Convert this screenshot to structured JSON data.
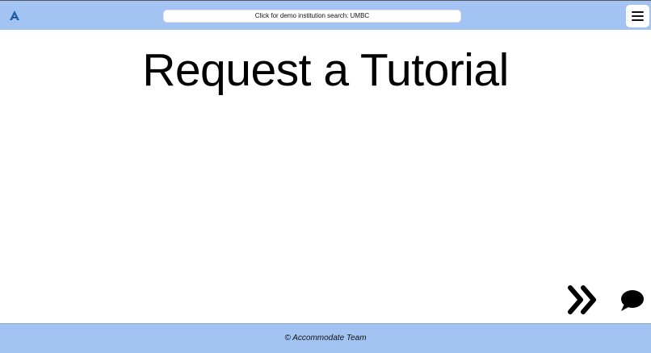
{
  "header": {
    "logo_icon": "accommodate-logo-icon",
    "demo_search_label": "Click for demo institution search: UMBC",
    "menu_icon": "hamburger-menu-icon",
    "background_color": "#a3c4f3"
  },
  "main": {
    "title": "Request a Tutorial"
  },
  "actions": {
    "next_icon": "double-chevron-right-icon",
    "chat_icon": "chat-bubble-icon"
  },
  "footer": {
    "text": "© Accommodate Team",
    "background_color": "#a3c4f3"
  }
}
